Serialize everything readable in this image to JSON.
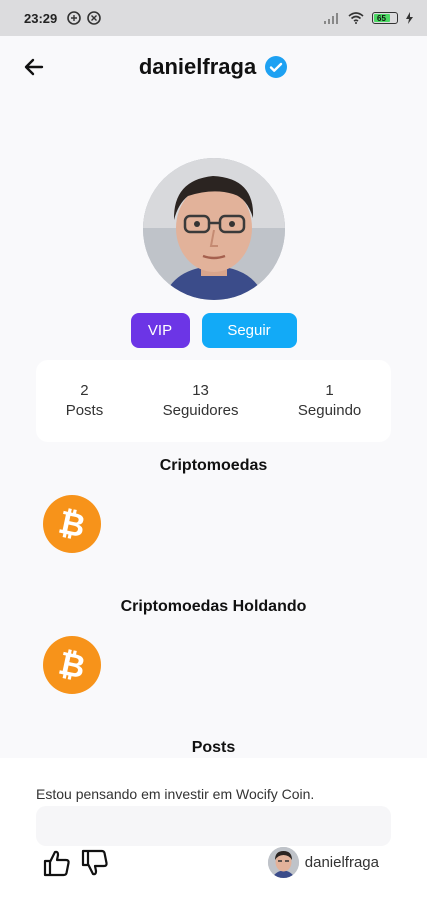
{
  "status_bar": {
    "time": "23:29",
    "battery": "65"
  },
  "header": {
    "title": "danielfraga",
    "back_icon": "arrow-left-icon",
    "verified_icon": "verified-badge-icon",
    "verified_color": "#1ea1f2"
  },
  "profile": {
    "vip_label": "VIP",
    "follow_label": "Seguir",
    "vip_color": "#6c35e6",
    "follow_color": "#12aaf7"
  },
  "stats": [
    {
      "value": "2",
      "label": "Posts"
    },
    {
      "value": "13",
      "label": "Seguidores"
    },
    {
      "value": "1",
      "label": "Seguindo"
    }
  ],
  "sections": {
    "crypto_title": "Criptomoedas",
    "holding_title": "Criptomoedas Holdando",
    "posts_title": "Posts",
    "coin_icon": "bitcoin-icon",
    "coin_color": "#f7931a"
  },
  "post": {
    "text": "Estou pensando em investir em Wocify Coin.",
    "author": "danielfraga",
    "like_icon": "thumbs-up-icon",
    "dislike_icon": "thumbs-down-icon"
  }
}
